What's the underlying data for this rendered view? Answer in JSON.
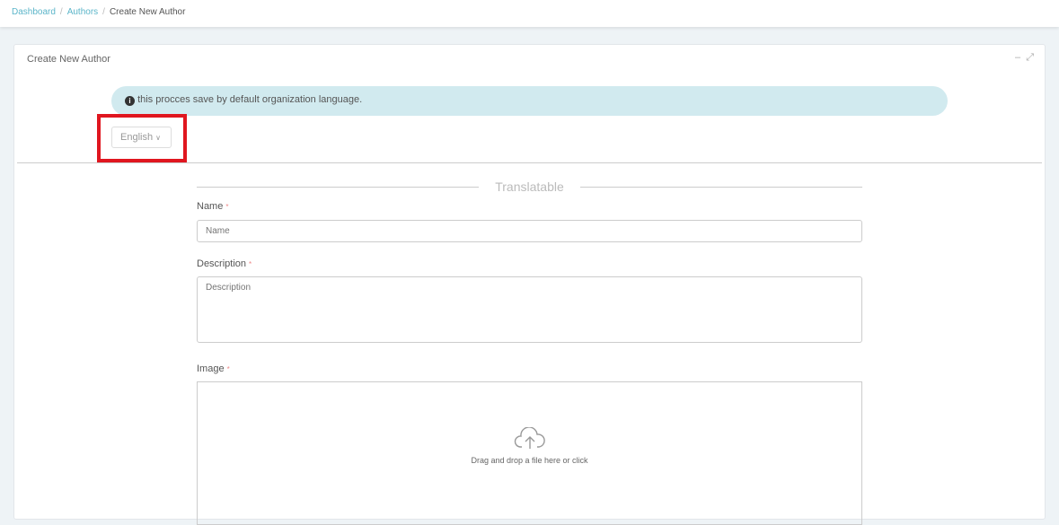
{
  "breadcrumb": {
    "items": [
      "Dashboard",
      "Authors"
    ],
    "current": "Create New Author"
  },
  "card": {
    "title": "Create New Author"
  },
  "alert": {
    "text": "this procces save by default organization language."
  },
  "language": {
    "selected": "English"
  },
  "form": {
    "section": "Translatable",
    "name": {
      "label": "Name",
      "placeholder": "Name"
    },
    "description": {
      "label": "Description",
      "placeholder": "Description"
    },
    "image": {
      "label": "Image",
      "hint": "Drag and drop a file here or click"
    }
  }
}
